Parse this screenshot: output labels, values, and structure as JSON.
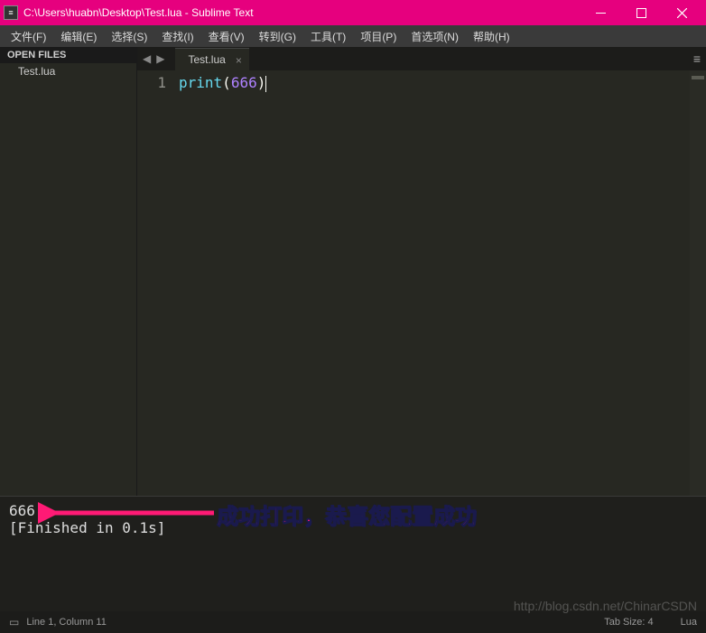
{
  "titlebar": {
    "title": "C:\\Users\\huabn\\Desktop\\Test.lua - Sublime Text"
  },
  "menubar": {
    "items": [
      "文件(F)",
      "编辑(E)",
      "选择(S)",
      "查找(I)",
      "查看(V)",
      "转到(G)",
      "工具(T)",
      "项目(P)",
      "首选项(N)",
      "帮助(H)"
    ]
  },
  "sidebar": {
    "open_files_label": "OPEN FILES",
    "files": [
      "Test.lua"
    ]
  },
  "tabs": {
    "active": {
      "label": "Test.lua"
    }
  },
  "code": {
    "line_number": "1",
    "fn": "print",
    "open": "(",
    "num": "666",
    "close": ")"
  },
  "console": {
    "output": "666",
    "finished": "[Finished in 0.1s]"
  },
  "statusbar": {
    "position": "Line 1, Column 11",
    "tab_size": "Tab Size: 4",
    "lang": "Lua"
  },
  "annotation": {
    "text": "成功打印，恭喜您配置成功"
  },
  "watermark": "http://blog.csdn.net/ChinarCSDN"
}
